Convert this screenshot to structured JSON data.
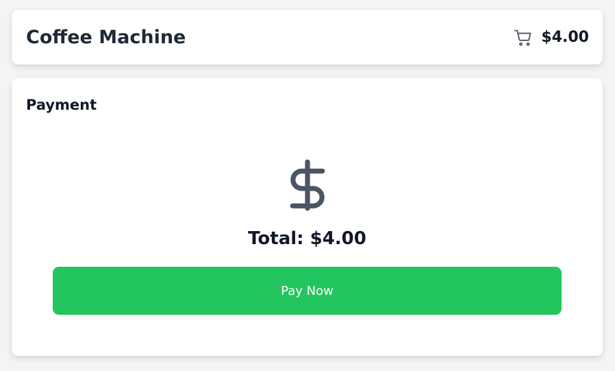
{
  "header": {
    "title": "Coffee Machine",
    "cart_icon": "shopping-cart-icon",
    "cart_total": "$4.00"
  },
  "payment": {
    "title": "Payment",
    "icon": "dollar-sign-icon",
    "total_label": "Total:",
    "total_amount": "$4.00",
    "pay_button_label": "Pay Now"
  },
  "colors": {
    "background": "#f3f4f6",
    "card": "#ffffff",
    "accent": "#22c55e",
    "icon": "#4b5563",
    "text": "#111827"
  }
}
